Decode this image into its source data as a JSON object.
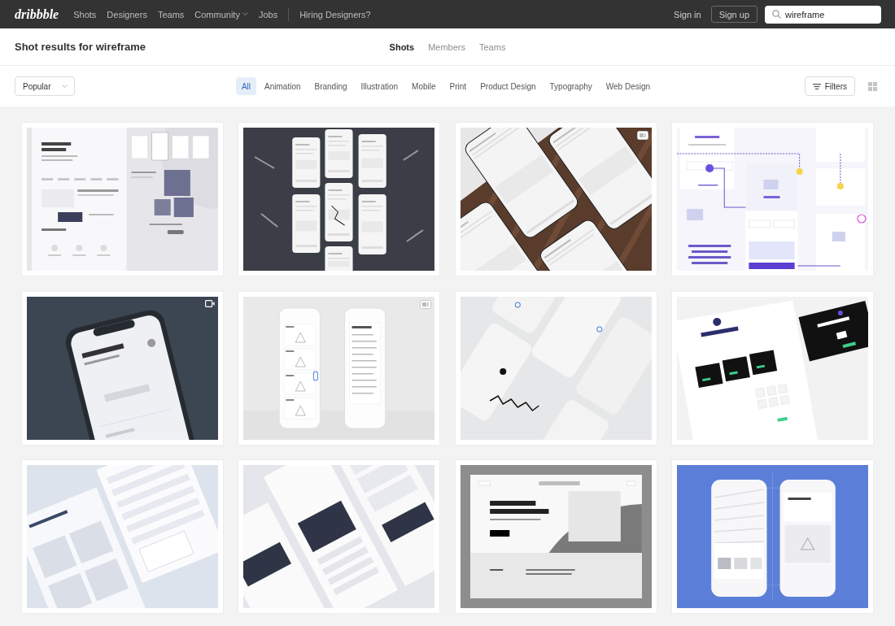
{
  "header": {
    "logo": "dribbble",
    "nav": [
      {
        "label": "Shots",
        "dropdown": false
      },
      {
        "label": "Designers",
        "dropdown": false
      },
      {
        "label": "Teams",
        "dropdown": false
      },
      {
        "label": "Community",
        "dropdown": true
      },
      {
        "label": "Jobs",
        "dropdown": false
      }
    ],
    "hiring_link": "Hiring Designers?",
    "sign_in": "Sign in",
    "sign_up": "Sign up",
    "search": {
      "value": "wireframe"
    }
  },
  "results": {
    "title": "Shot results for wireframe",
    "tabs": [
      {
        "label": "Shots",
        "selected": true
      },
      {
        "label": "Members",
        "selected": false
      },
      {
        "label": "Teams",
        "selected": false
      }
    ]
  },
  "filter_bar": {
    "sort": "Popular",
    "categories": [
      {
        "label": "All",
        "selected": true
      },
      {
        "label": "Animation",
        "selected": false
      },
      {
        "label": "Branding",
        "selected": false
      },
      {
        "label": "Illustration",
        "selected": false
      },
      {
        "label": "Mobile",
        "selected": false
      },
      {
        "label": "Print",
        "selected": false
      },
      {
        "label": "Product Design",
        "selected": false
      },
      {
        "label": "Typography",
        "selected": false
      },
      {
        "label": "Web Design",
        "selected": false
      }
    ],
    "filters_button": "Filters"
  },
  "shots": [
    {
      "kind": "web-page",
      "multi_shot": false,
      "video": false
    },
    {
      "kind": "phones-dark",
      "multi_shot": false,
      "video": false
    },
    {
      "kind": "phones-wood",
      "multi_shot": true,
      "video": false
    },
    {
      "kind": "flow-diagram",
      "multi_shot": false,
      "video": false
    },
    {
      "kind": "phone-dark",
      "multi_shot": false,
      "video": true
    },
    {
      "kind": "phones-light",
      "multi_shot": true,
      "video": false
    },
    {
      "kind": "map-app",
      "multi_shot": false,
      "video": false
    },
    {
      "kind": "pricing-page",
      "multi_shot": false,
      "video": false
    },
    {
      "kind": "dashboard-tilted",
      "multi_shot": false,
      "video": false
    },
    {
      "kind": "web-tilted",
      "multi_shot": false,
      "video": false
    },
    {
      "kind": "landing-page",
      "multi_shot": false,
      "video": false
    },
    {
      "kind": "phones-blue",
      "multi_shot": false,
      "video": false
    }
  ]
}
